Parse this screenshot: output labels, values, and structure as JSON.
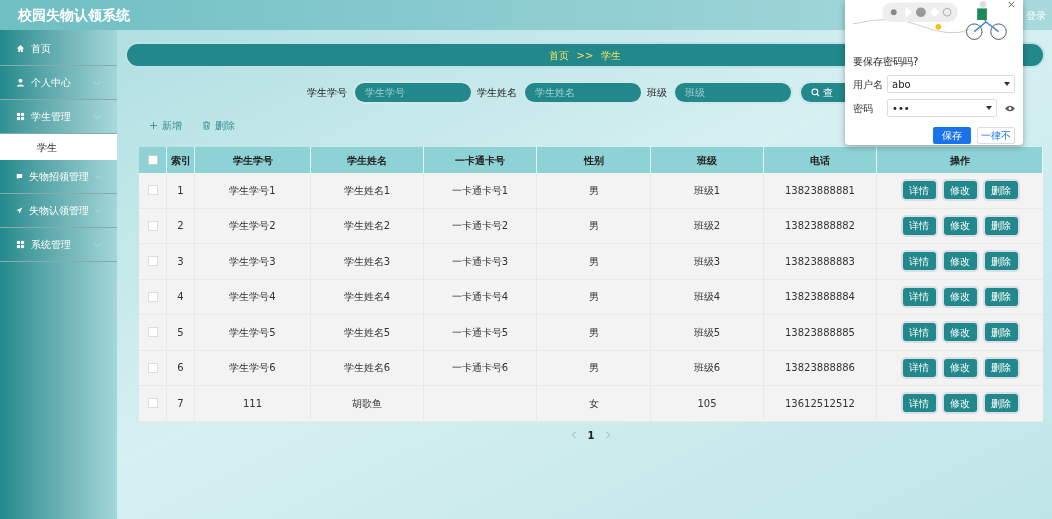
{
  "header": {
    "title": "校园失物认领系统",
    "right_link": "登录"
  },
  "sidebar": {
    "items": [
      {
        "label": "首页",
        "has_arrow": false,
        "expanded": false
      },
      {
        "label": "个人中心",
        "has_arrow": true,
        "expanded": false
      },
      {
        "label": "学生管理",
        "has_arrow": true,
        "expanded": true,
        "children": [
          {
            "label": "学生",
            "selected": true
          }
        ]
      },
      {
        "label": "失物招领管理",
        "has_arrow": true,
        "expanded": false
      },
      {
        "label": "失物认领管理",
        "has_arrow": true,
        "expanded": false
      },
      {
        "label": "系统管理",
        "has_arrow": true,
        "expanded": false
      }
    ]
  },
  "breadcrumb": {
    "items": [
      "首页",
      "学生"
    ],
    "separator": ">>"
  },
  "search": {
    "fields": [
      {
        "label": "学生学号",
        "placeholder": "学生学号"
      },
      {
        "label": "学生姓名",
        "placeholder": "学生姓名"
      },
      {
        "label": "班级",
        "placeholder": "班级"
      }
    ],
    "button": "查"
  },
  "toolbar": [
    {
      "kind": "add",
      "label": "新增"
    },
    {
      "kind": "delete",
      "label": "删除"
    }
  ],
  "table": {
    "select_all_checked": false,
    "columns": [
      "索引",
      "学生学号",
      "学生姓名",
      "一卡通卡号",
      "性别",
      "班级",
      "电话",
      "操作"
    ],
    "rows": [
      {
        "checked": false,
        "cells": [
          "1",
          "学生学号1",
          "学生姓名1",
          "一卡通卡号1",
          "男",
          "班级1",
          "13823888881"
        ],
        "actions": [
          "详情",
          "修改",
          "删除"
        ]
      },
      {
        "checked": false,
        "cells": [
          "2",
          "学生学号2",
          "学生姓名2",
          "一卡通卡号2",
          "男",
          "班级2",
          "13823888882"
        ],
        "actions": [
          "详情",
          "修改",
          "删除"
        ]
      },
      {
        "checked": false,
        "cells": [
          "3",
          "学生学号3",
          "学生姓名3",
          "一卡通卡号3",
          "男",
          "班级3",
          "13823888883"
        ],
        "actions": [
          "详情",
          "修改",
          "删除"
        ]
      },
      {
        "checked": false,
        "cells": [
          "4",
          "学生学号4",
          "学生姓名4",
          "一卡通卡号4",
          "男",
          "班级4",
          "13823888884"
        ],
        "actions": [
          "详情",
          "修改",
          "删除"
        ]
      },
      {
        "checked": false,
        "cells": [
          "5",
          "学生学号5",
          "学生姓名5",
          "一卡通卡号5",
          "男",
          "班级5",
          "13823888885"
        ],
        "actions": [
          "详情",
          "修改",
          "删除"
        ]
      },
      {
        "checked": false,
        "cells": [
          "6",
          "学生学号6",
          "学生姓名6",
          "一卡通卡号6",
          "男",
          "班级6",
          "13823888886"
        ],
        "actions": [
          "详情",
          "修改",
          "删除"
        ]
      },
      {
        "checked": false,
        "cells": [
          "7",
          "111",
          "胡歌鱼",
          null,
          "女",
          "105",
          "13612512512"
        ],
        "actions": [
          "详情",
          "修改",
          "删除"
        ]
      }
    ]
  },
  "pagination": {
    "pages": [
      {
        "label": "1",
        "selected": true
      }
    ]
  },
  "password_dialog": {
    "title": "要保存密码吗?",
    "username_label": "用户名",
    "username": "abo",
    "password_label": "密码",
    "password": "•••",
    "buttons": [
      {
        "label": "保存",
        "primary": true
      },
      {
        "label": "一律不",
        "primary": false
      }
    ]
  }
}
